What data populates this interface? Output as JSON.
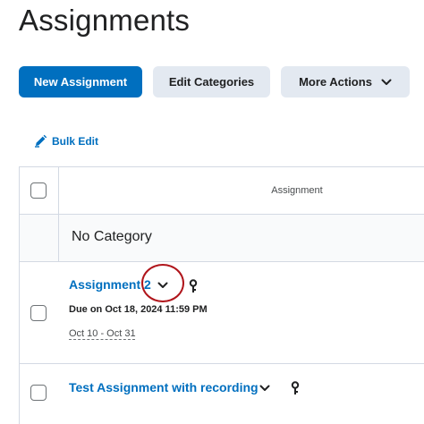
{
  "header": {
    "title": "Assignments"
  },
  "toolbar": {
    "new_assignment_label": "New Assignment",
    "edit_categories_label": "Edit Categories",
    "more_actions_label": "More Actions"
  },
  "bulk_edit": {
    "label": "Bulk Edit"
  },
  "table": {
    "column_header": "Assignment",
    "category": "No Category",
    "rows": [
      {
        "title": "Assignment 2",
        "due": "Due on Oct 18, 2024 11:59 PM",
        "availability": "Oct 10 - Oct 31"
      },
      {
        "title": "Test Assignment with recording"
      }
    ]
  },
  "colors": {
    "primary": "#006fbf",
    "secondary_button": "#e3e9f1",
    "highlight": "#b0151b",
    "border": "#d3d9e3"
  },
  "icons": {
    "bulk_edit": "pencil-icon",
    "dropdown": "chevron-down-icon",
    "special_access": "key-icon"
  }
}
